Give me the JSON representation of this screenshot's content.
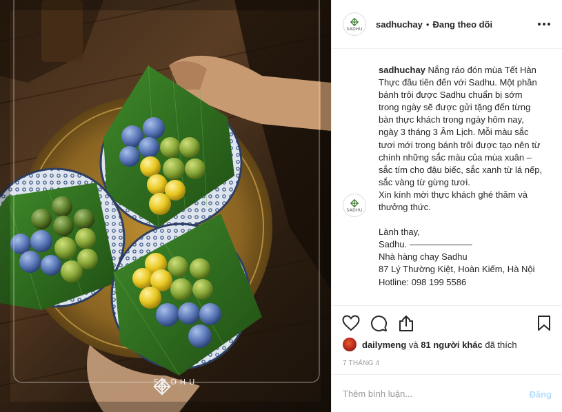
{
  "post": {
    "account": "sadhuchay",
    "separator": "•",
    "follow_status": "Đang theo dõi",
    "logo_text": "SADHU",
    "watermark_text": "SADHU",
    "caption": {
      "username": "sadhuchay",
      "lines": [
        " Nắng ráo đón mùa Tết Hàn Thực đầu tiên đến với Sadhu. Một phần bánh trôi được Sadhu chuẩn bị sớm trong ngày sẽ được gửi tặng đến từng bàn thực khách trong ngày hôm nay, ngày 3 tháng 3 Âm Lịch. Mỗi màu sắc tươi mới trong bánh trôi được tạo nên từ chính những sắc màu của mùa xuân – sắc tím cho đậu biếc, sắc xanh từ lá nếp, sắc vàng từ gừng tươi.",
        "Xin kính mời thực khách ghé thăm và thưởng thức.",
        "Lành thay,",
        "Sadhu. ———————",
        "Nhà hàng chay Sadhu",
        "87 Lý Thường Kiệt, Hoàn Kiếm, Hà Nội",
        "Hotline: 098 199 5586"
      ]
    },
    "likes": {
      "first_liker": "dailymeng",
      "connector": " và ",
      "others": "81 người khác",
      "suffix": " đã thích"
    },
    "timestamp": "7 THÁNG 4",
    "comment_placeholder": "Thêm bình luận...",
    "post_button": "Đăng"
  },
  "icons": {
    "more": "more-options-icon",
    "like": "heart-icon",
    "comment": "comment-bubble-icon",
    "share": "share-icon",
    "save": "bookmark-icon",
    "logo": "endless-knot-icon"
  },
  "colors": {
    "text": "#262626",
    "muted": "#999999",
    "border": "#efefef",
    "post_disabled": "#b2dffc",
    "banana_leaf": "#2f6b1f",
    "cake_blue": "#5b78b8",
    "cake_green": "#8aa83a",
    "cake_yellow": "#e8c820"
  }
}
